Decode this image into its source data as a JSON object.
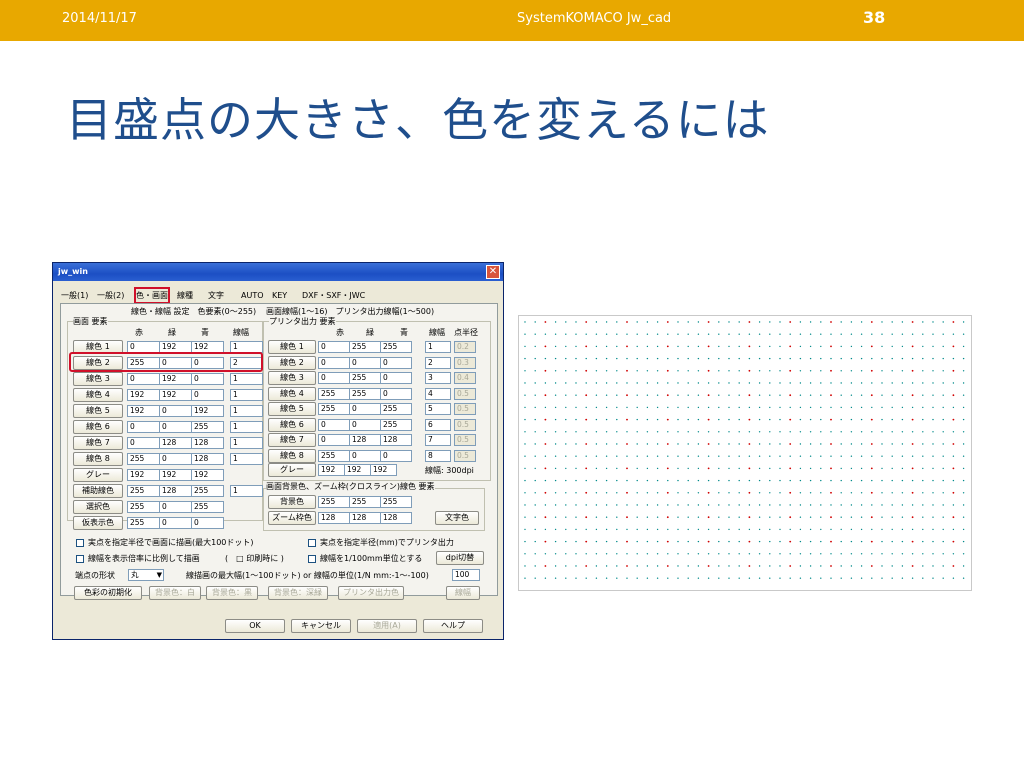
{
  "slide": {
    "date": "2014/11/17",
    "footer_title": "SystemKOMACO Jw_cad",
    "page_number": "38",
    "title": "目盛点の大きさ、色を変えるには",
    "accent_color": "#e8a800",
    "title_color": "#1f4e8c",
    "highlight_color": "#d0102a"
  },
  "dialog": {
    "window_title": "jw_win",
    "tabs": [
      "一般(1)",
      "一般(2)",
      "色・画面",
      "線種",
      "文字",
      "AUTO",
      "KEY",
      "DXF・SXF・JWC"
    ],
    "left": {
      "heading": "線色・線幅 設定　色要素(0〜255)",
      "group_label": "画面 要素",
      "col_headers": [
        "赤",
        "緑",
        "青",
        "線幅"
      ],
      "rows": [
        {
          "label": "線色 1",
          "v": [
            "0",
            "192",
            "192",
            "1"
          ]
        },
        {
          "label": "線色 2",
          "v": [
            "255",
            "0",
            "0",
            "2"
          ]
        },
        {
          "label": "線色 3",
          "v": [
            "0",
            "192",
            "0",
            "1"
          ]
        },
        {
          "label": "線色 4",
          "v": [
            "192",
            "192",
            "0",
            "1"
          ]
        },
        {
          "label": "線色 5",
          "v": [
            "192",
            "0",
            "192",
            "1"
          ]
        },
        {
          "label": "線色 6",
          "v": [
            "0",
            "0",
            "255",
            "1"
          ]
        },
        {
          "label": "線色 7",
          "v": [
            "0",
            "128",
            "128",
            "1"
          ]
        },
        {
          "label": "線色 8",
          "v": [
            "255",
            "0",
            "128",
            "1"
          ]
        },
        {
          "label": "グレー",
          "v": [
            "192",
            "192",
            "192",
            ""
          ]
        },
        {
          "label": "補助線色",
          "v": [
            "255",
            "128",
            "255",
            "1"
          ]
        },
        {
          "label": "選択色",
          "v": [
            "255",
            "0",
            "255",
            ""
          ]
        },
        {
          "label": "仮表示色",
          "v": [
            "255",
            "0",
            "0",
            ""
          ]
        }
      ]
    },
    "right": {
      "heading": "画面線幅(1〜16)　プリンタ出力線幅(1〜500)",
      "group_label": "プリンタ出力 要素",
      "col_headers": [
        "赤",
        "緑",
        "青",
        "線幅",
        "点半径"
      ],
      "rows": [
        {
          "label": "線色 1",
          "v": [
            "0",
            "255",
            "255",
            "1",
            "0.2"
          ]
        },
        {
          "label": "線色 2",
          "v": [
            "0",
            "0",
            "0",
            "2",
            "0.3"
          ]
        },
        {
          "label": "線色 3",
          "v": [
            "0",
            "255",
            "0",
            "3",
            "0.4"
          ]
        },
        {
          "label": "線色 4",
          "v": [
            "255",
            "255",
            "0",
            "4",
            "0.5"
          ]
        },
        {
          "label": "線色 5",
          "v": [
            "255",
            "0",
            "255",
            "5",
            "0.5"
          ]
        },
        {
          "label": "線色 6",
          "v": [
            "0",
            "0",
            "255",
            "6",
            "0.5"
          ]
        },
        {
          "label": "線色 7",
          "v": [
            "0",
            "128",
            "128",
            "7",
            "0.5"
          ]
        },
        {
          "label": "線色 8",
          "v": [
            "255",
            "0",
            "0",
            "8",
            "0.5"
          ]
        }
      ],
      "gray": {
        "label": "グレー",
        "v": [
          "192",
          "192",
          "192"
        ]
      },
      "line_width_label": "線幅: 300dpi",
      "bg_group_label": "画面背景色、ズーム枠(クロスライン)線色 要素",
      "bg_rows": [
        {
          "label": "背景色",
          "v": [
            "255",
            "255",
            "255"
          ]
        },
        {
          "label": "ズーム枠色",
          "v": [
            "128",
            "128",
            "128"
          ]
        }
      ],
      "text_color_button": "文字色"
    },
    "options": {
      "chk1": "実点を指定半径で画面に描画(最大100ドット)",
      "chk2": "実点を指定半径(mm)でプリンタ出力",
      "chk3": "線幅を表示倍率に比例して描画",
      "print_paren": "(　□ 印刷時に )",
      "chk4": "線幅を1/100mm単位とする",
      "dpi_button": "dpi切替",
      "point_shape_label": "端点の形状",
      "point_shape_value": "丸",
      "max_width_label": "線描画の最大幅(1〜100ドット) or 線幅の単位(1/N mm:-1〜-100)",
      "max_width_value": "100"
    },
    "bottom_buttons": [
      "色彩の初期化",
      "背景色：白",
      "背景色：黒",
      "背景色：深緑",
      "プリンタ出力色",
      "線幅"
    ],
    "footer_buttons": [
      "OK",
      "キャンセル",
      "適用(A)",
      "ヘルプ"
    ]
  }
}
